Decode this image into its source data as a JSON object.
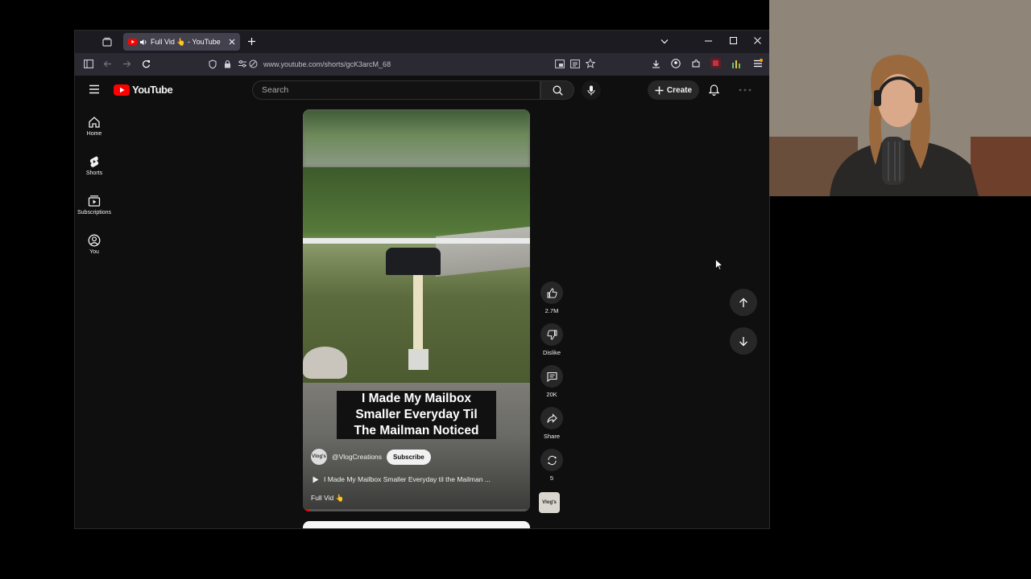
{
  "browser": {
    "tab": {
      "title": "Full Vid 👆 - YouTube"
    },
    "url": "www.youtube.com/shorts/gcK3arcM_68",
    "window_controls": [
      "minimize",
      "maximize",
      "close"
    ]
  },
  "youtube": {
    "logo_text": "YouTube",
    "search": {
      "placeholder": "Search"
    },
    "create_label": "Create",
    "sidebar": [
      {
        "label": "Home",
        "icon": "home-icon"
      },
      {
        "label": "Shorts",
        "icon": "shorts-icon"
      },
      {
        "label": "Subscriptions",
        "icon": "subscriptions-icon"
      },
      {
        "label": "You",
        "icon": "you-icon"
      }
    ],
    "short": {
      "overlay_caption": [
        "I Made My Mailbox",
        "Smaller Everyday Til",
        "The Mailman Noticed"
      ],
      "channel": "@VlogCreations",
      "channel_avatar_text": "Vlog's",
      "subscribe_label": "Subscribe",
      "related_title": "I Made My Mailbox Smaller Everyday til the Mailman ...",
      "description": "Full Vid 👆",
      "progress": 0.03
    },
    "actions": {
      "likes": "2.7M",
      "dislike": "Dislike",
      "comments": "20K",
      "share": "Share",
      "remix": "5"
    }
  },
  "colors": {
    "accent": "#ff0000",
    "page_bg": "#0f0f0f",
    "chip_bg": "#272727"
  }
}
